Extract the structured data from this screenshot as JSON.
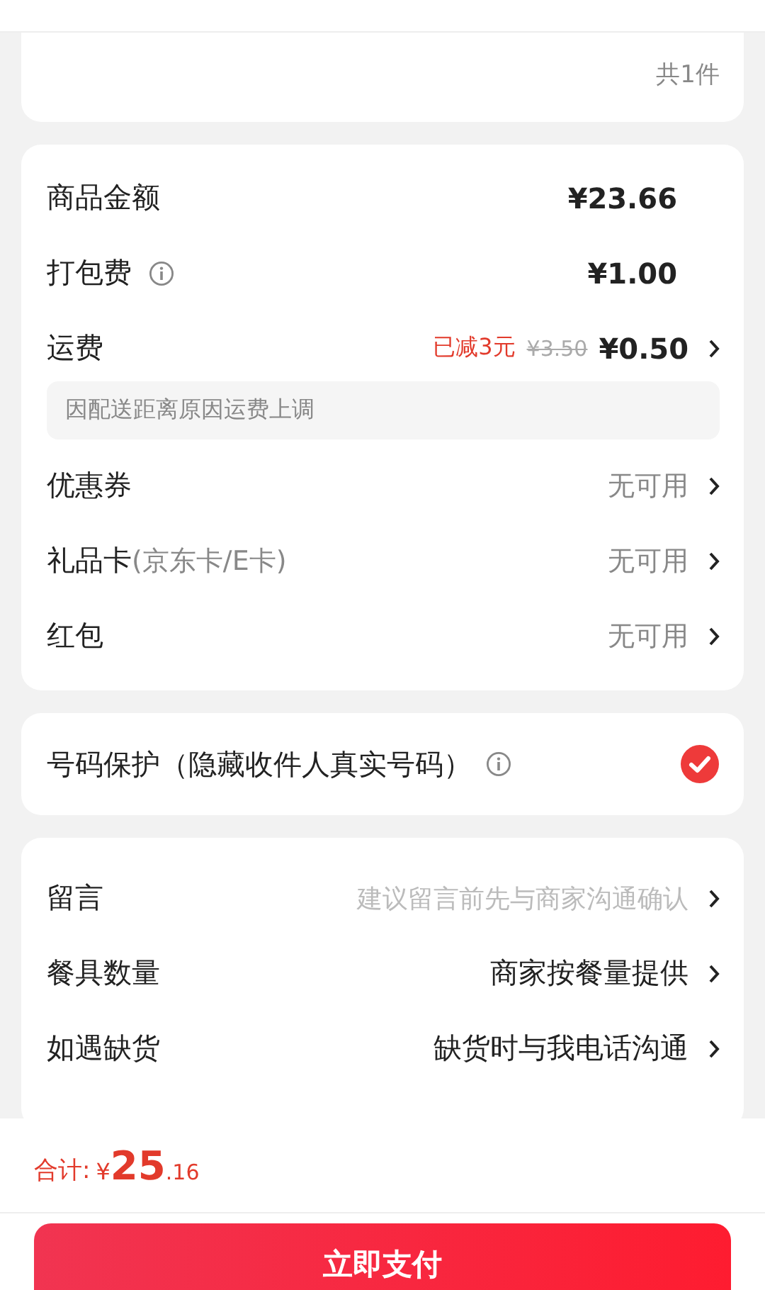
{
  "item_count": "共1件",
  "fees": [
    {
      "kind": "amount",
      "label": "商品金额",
      "value": "¥23.66"
    },
    {
      "kind": "info",
      "label": "打包费",
      "value": "¥1.00"
    },
    {
      "kind": "discount",
      "label": "运费",
      "discount": "已减3元",
      "original": "¥3.50",
      "value": "¥0.50",
      "note": "因配送距离原因运费上调"
    },
    {
      "kind": "link",
      "label": "优惠券",
      "value": "无可用"
    },
    {
      "kind": "link",
      "label": "礼品卡",
      "sublabel": "(京东卡/E卡)",
      "value": "无可用"
    },
    {
      "kind": "link",
      "label": "红包",
      "value": "无可用"
    }
  ],
  "privacy": {
    "label": "号码保护（隐藏收件人真实号码）",
    "checked": true
  },
  "options": [
    {
      "label": "留言",
      "placeholder": "建议留言前先与商家沟通确认"
    },
    {
      "label": "餐具数量",
      "value": "商家按餐量提供"
    },
    {
      "label": "如遇缺货",
      "value": "缺货时与我电话沟通"
    }
  ],
  "total": {
    "label": "合计:",
    "currency": "¥",
    "integer": "25",
    "decimal": ".16"
  },
  "pay_button": "立即支付"
}
